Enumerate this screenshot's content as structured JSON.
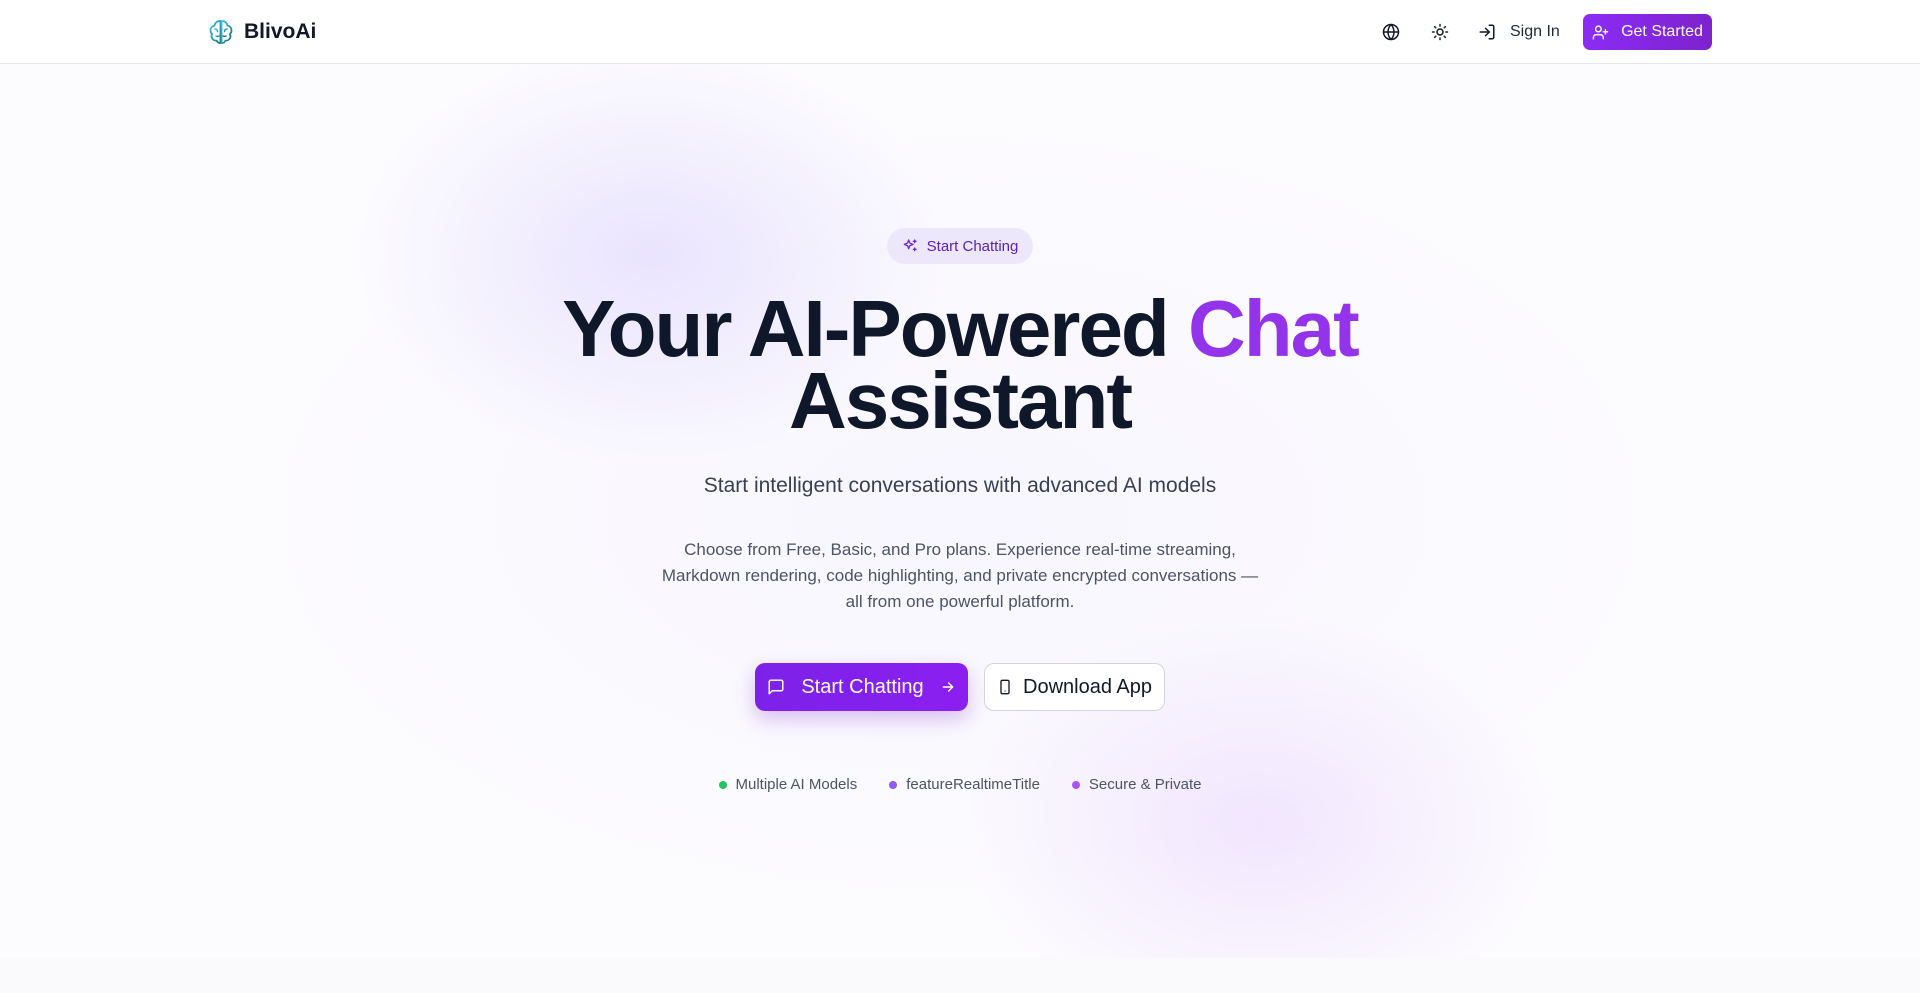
{
  "header": {
    "brand_name": "BlivoAi",
    "signin_label": "Sign In",
    "get_started_label": "Get Started"
  },
  "hero": {
    "badge_label": "Start Chatting",
    "headline_main": "Your AI-Powered ",
    "headline_accent": "Chat",
    "headline_line2": "Assistant",
    "subtitle": "Start intelligent conversations with advanced AI models",
    "description": "Choose from Free, Basic, and Pro plans. Experience real-time streaming, Markdown rendering, code highlighting, and private encrypted conversations — all from one powerful platform.",
    "primary_cta": "Start Chatting",
    "secondary_cta": "Download App"
  },
  "features": [
    {
      "label": "Multiple AI Models",
      "color": "#22c55e"
    },
    {
      "label": "featureRealtimeTitle",
      "color": "#8b5cf6"
    },
    {
      "label": "Secure & Private",
      "color": "#a855f7"
    }
  ],
  "colors": {
    "accent": "#9333ea",
    "primary_button": "#7e22ce",
    "badge_bg": "#ede7fb"
  },
  "icons": {
    "logo": "brain-icon",
    "language": "globe-icon",
    "theme": "sun-icon",
    "signin": "log-in-icon",
    "get_started": "user-plus-icon",
    "badge": "sparkles-icon",
    "chat": "message-square-icon",
    "arrow": "arrow-right-icon",
    "phone": "smartphone-icon"
  }
}
